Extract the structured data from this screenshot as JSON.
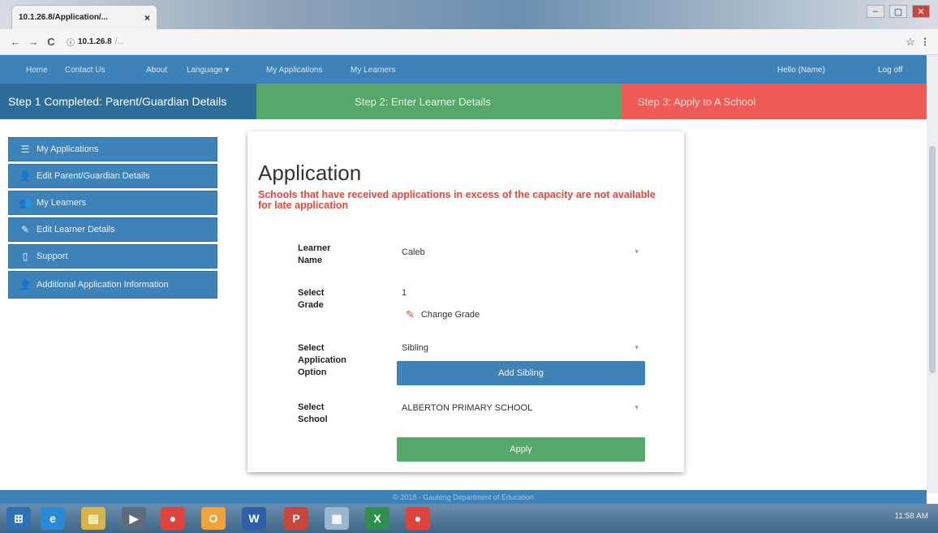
{
  "browser": {
    "tab_title": "10.1.26.8/Application/...",
    "tab_close": "×",
    "url_host": "10.1.26.8",
    "url_path": "/...",
    "back_icon": "←",
    "forward_icon": "→",
    "reload_icon": "C",
    "info_icon": "ⓘ",
    "star_icon": "☆",
    "menu_icon": "⋮",
    "win_min": "–",
    "win_max": "▢",
    "win_close": "✕"
  },
  "navbar": {
    "left": [
      {
        "label": "Home"
      },
      {
        "label": "Contact Us"
      },
      {
        "label": "About"
      },
      {
        "label": "Language"
      }
    ],
    "middle": [
      {
        "label": "My Applications"
      },
      {
        "label": "My Learners"
      }
    ],
    "greeting": "Hello (Name)",
    "logout": "Log off"
  },
  "steps": {
    "step1": "Step 1 Completed: Parent/Guardian Details",
    "step2": "Step 2: Enter Learner Details",
    "step3": "Step 3: Apply to A School"
  },
  "sidebar": {
    "items": [
      {
        "icon": "☰",
        "label": "My Applications"
      },
      {
        "icon": "👤",
        "label": "Edit Parent/Guardian Details"
      },
      {
        "icon": "👥",
        "label": "My Learners"
      },
      {
        "icon": "✎",
        "label": "Edit Learner Details"
      },
      {
        "icon": "▯",
        "label": "Support"
      },
      {
        "icon": "👤",
        "label": "Additional Application Information"
      }
    ]
  },
  "form": {
    "title": "Application",
    "warning": "Schools that have received applications in excess of the capacity are not available for late application",
    "learner_label": "Learner Name",
    "learner_value": "Caleb",
    "grade_label": "Select Grade",
    "grade_value": "1",
    "change_grade": "Change Grade",
    "option_label": "Select Application Option",
    "option_value": "Sibling",
    "add_sibling": "Add Sibling",
    "school_label": "Select School",
    "school_value": "ALBERTON PRIMARY SCHOOL",
    "apply": "Apply",
    "caret": "▾",
    "pencil": "✎"
  },
  "footer": {
    "text": "© 2018 - Gauteng Department of Education"
  },
  "taskbar": {
    "apps": [
      {
        "label": "⊞",
        "color": "#2f6fb3"
      },
      {
        "label": "e",
        "color": "#2a8ad6"
      },
      {
        "label": "▤",
        "color": "#d9b34a"
      },
      {
        "label": "▶",
        "color": "#5d6b7a"
      },
      {
        "label": "●",
        "color": "#e0453b"
      },
      {
        "label": "O",
        "color": "#f2a23b"
      },
      {
        "label": "W",
        "color": "#2d5fa8"
      },
      {
        "label": "P",
        "color": "#c9463d"
      },
      {
        "label": "▦",
        "color": "#9bb7cf"
      },
      {
        "label": "X",
        "color": "#2f8f4e"
      },
      {
        "label": "●",
        "color": "#e0453b"
      }
    ],
    "clock": "11:58 AM"
  }
}
